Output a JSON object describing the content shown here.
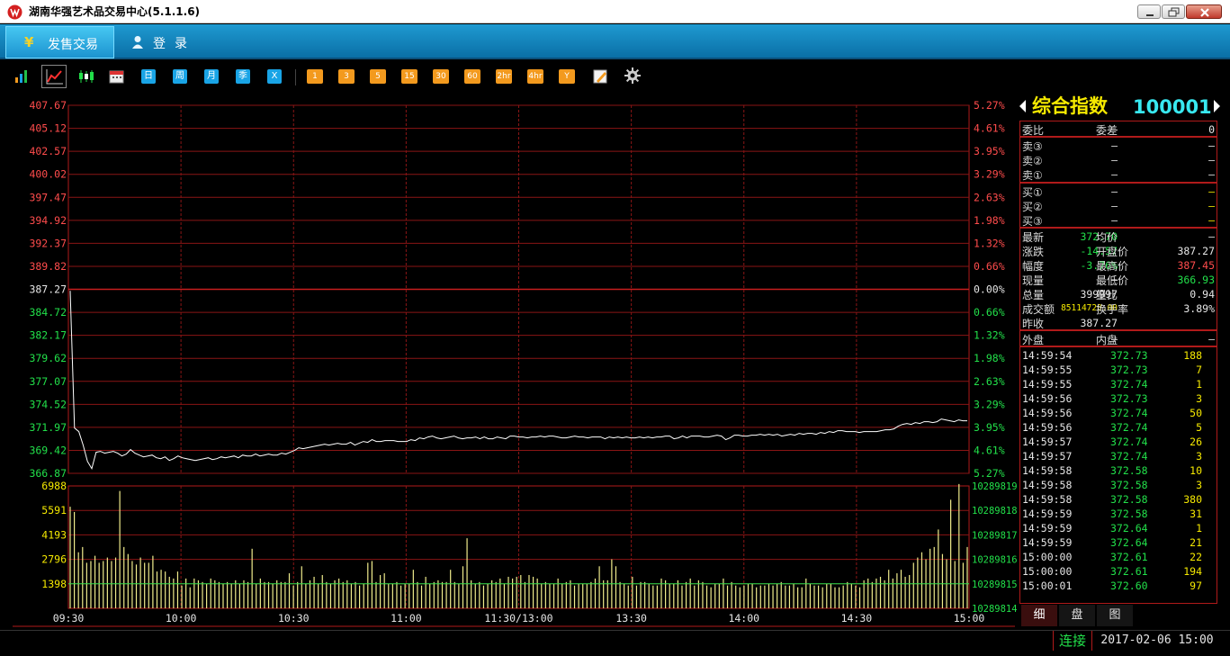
{
  "window": {
    "title": "湖南华强艺术品交易中心(5.1.1.6)"
  },
  "nav": {
    "trade_label": "发售交易",
    "login_label": "登录"
  },
  "toolbar": {
    "periods": [
      "日",
      "周",
      "月",
      "季",
      "X"
    ],
    "minutes": [
      "1",
      "3",
      "5",
      "15",
      "30",
      "60",
      "2hr",
      "4hr",
      "Y"
    ],
    "icons": [
      "bar-chart-icon",
      "line-chart-icon",
      "candlestick-icon",
      "calendar-icon",
      "draw-icon",
      "gear-icon"
    ]
  },
  "quote": {
    "name": "综合指数",
    "code": "100001",
    "weibi_label": "委比",
    "weibi_value": "—",
    "weicha_label": "委差",
    "weicha_value": "0",
    "sells": [
      {
        "label": "卖③",
        "price": "—",
        "vol": "—"
      },
      {
        "label": "卖②",
        "price": "—",
        "vol": "—"
      },
      {
        "label": "卖①",
        "price": "—",
        "vol": "—"
      }
    ],
    "buys": [
      {
        "label": "买①",
        "price": "—",
        "vol": "—"
      },
      {
        "label": "买②",
        "price": "—",
        "vol": "—"
      },
      {
        "label": "买③",
        "price": "—",
        "vol": "—"
      }
    ],
    "stats_left": [
      {
        "label": "最新",
        "value": "372.70",
        "color": "grn"
      },
      {
        "label": "涨跌",
        "value": "-14.57",
        "color": "grn"
      },
      {
        "label": "幅度",
        "value": "-3.76%",
        "color": "grn"
      },
      {
        "label": "现量",
        "value": "—",
        "color": "wht"
      },
      {
        "label": "总量",
        "value": "399997",
        "color": "wht"
      },
      {
        "label": "成交额",
        "value": "85114720.00",
        "color": "yel"
      },
      {
        "label": "昨收",
        "value": "387.27",
        "color": "wht"
      }
    ],
    "stats_right": [
      {
        "label": "均价",
        "value": "—",
        "color": "wht"
      },
      {
        "label": "开盘价",
        "value": "387.27",
        "color": "wht"
      },
      {
        "label": "最高价",
        "value": "387.45",
        "color": "red"
      },
      {
        "label": "最低价",
        "value": "366.93",
        "color": "grn"
      },
      {
        "label": "量比",
        "value": "0.94",
        "color": "wht"
      },
      {
        "label": "换手率",
        "value": "3.89%",
        "color": "wht"
      }
    ],
    "outer_label": "外盘",
    "outer_value": "—",
    "inner_label": "内盘",
    "inner_value": "—"
  },
  "ticks": [
    [
      "14:59:54",
      "372.73",
      "188"
    ],
    [
      "14:59:55",
      "372.73",
      "7"
    ],
    [
      "14:59:55",
      "372.74",
      "1"
    ],
    [
      "14:59:56",
      "372.73",
      "3"
    ],
    [
      "14:59:56",
      "372.74",
      "50"
    ],
    [
      "14:59:56",
      "372.74",
      "5"
    ],
    [
      "14:59:57",
      "372.74",
      "26"
    ],
    [
      "14:59:57",
      "372.74",
      "3"
    ],
    [
      "14:59:58",
      "372.58",
      "10"
    ],
    [
      "14:59:58",
      "372.58",
      "3"
    ],
    [
      "14:59:58",
      "372.58",
      "380"
    ],
    [
      "14:59:59",
      "372.58",
      "31"
    ],
    [
      "14:59:59",
      "372.64",
      "1"
    ],
    [
      "14:59:59",
      "372.64",
      "21"
    ],
    [
      "15:00:00",
      "372.61",
      "22"
    ],
    [
      "15:00:00",
      "372.61",
      "194"
    ],
    [
      "15:00:01",
      "372.60",
      "97"
    ]
  ],
  "tabs": [
    "细",
    "盘",
    "图"
  ],
  "status": {
    "connection": "连接",
    "datetime": "2017-02-06 15:00"
  },
  "chart_data": {
    "type": "line",
    "prev_close": 387.27,
    "price_labels": [
      "407.67",
      "405.12",
      "402.57",
      "400.02",
      "397.47",
      "394.92",
      "392.37",
      "389.82",
      "387.27",
      "384.72",
      "382.17",
      "379.62",
      "377.07",
      "374.52",
      "371.97",
      "369.42",
      "366.87"
    ],
    "pct_labels": [
      "5.27%",
      "4.61%",
      "3.95%",
      "3.29%",
      "2.63%",
      "1.98%",
      "1.32%",
      "0.66%",
      "0.00%",
      "0.66%",
      "1.32%",
      "1.98%",
      "2.63%",
      "3.29%",
      "3.95%",
      "4.61%",
      "5.27%"
    ],
    "ylim": [
      366.87,
      407.67
    ],
    "x_labels": [
      "09:30",
      "10:00",
      "10:30",
      "11:00",
      "11:30/13:00",
      "13:30",
      "14:00",
      "14:30",
      "15:00"
    ],
    "price_series": [
      387.1,
      371.9,
      371.5,
      370.0,
      368.2,
      367.4,
      369.2,
      369.3,
      369.1,
      369.2,
      369.3,
      369.1,
      368.8,
      369.0,
      369.5,
      369.1,
      368.9,
      368.7,
      368.8,
      368.9,
      368.6,
      368.5,
      368.7,
      368.3,
      368.5,
      368.8,
      368.6,
      368.5,
      368.4,
      368.3,
      368.4,
      368.5,
      368.6,
      368.4,
      368.5,
      368.7,
      368.6,
      368.7,
      368.8,
      368.6,
      368.9,
      368.8,
      368.8,
      369.0,
      368.8,
      368.9,
      369.0,
      368.9,
      368.9,
      369.1,
      369.0,
      369.2,
      369.4,
      369.7,
      369.6,
      369.7,
      369.8,
      369.9,
      370.0,
      370.1,
      370.0,
      370.1,
      370.2,
      370.1,
      370.1,
      370.3,
      370.0,
      370.2,
      370.4,
      370.3,
      370.6,
      370.4,
      370.4,
      370.5,
      370.5,
      370.5,
      370.4,
      370.4,
      370.4,
      370.6,
      370.5,
      370.8,
      370.7,
      370.9,
      371.0,
      370.8,
      370.7,
      370.8,
      370.9,
      371.0,
      370.8,
      370.7,
      370.8,
      370.8,
      370.9,
      370.7,
      370.9,
      370.7,
      370.7,
      370.9,
      370.8,
      370.7,
      371.0,
      371.0,
      370.9,
      370.9,
      370.8,
      370.9,
      370.9,
      371.0,
      370.9,
      371.0,
      371.0,
      370.9,
      370.8,
      370.8,
      370.9,
      371.0,
      370.9,
      370.9,
      370.8,
      370.9,
      370.9,
      370.9,
      370.7,
      370.9,
      370.8,
      370.9,
      370.8,
      370.9,
      370.8,
      370.8,
      370.9,
      370.8,
      370.9,
      370.8,
      370.9,
      370.9,
      371.0,
      371.0,
      370.7,
      370.8,
      371.0,
      370.8,
      371.0,
      371.0,
      371.0,
      370.9,
      370.9,
      371.0,
      371.1,
      371.0,
      370.6,
      370.8,
      371.1,
      371.1,
      371.0,
      371.0,
      371.1,
      371.1,
      371.2,
      371.1,
      371.2,
      371.1,
      371.2,
      371.0,
      371.1,
      371.2,
      371.1,
      371.3,
      371.2,
      371.3,
      371.3,
      371.2,
      371.4,
      371.3,
      371.5,
      371.4,
      371.6,
      371.6,
      371.5,
      371.5,
      371.5,
      371.4,
      371.5,
      371.5,
      371.5,
      371.5,
      371.6,
      371.7,
      371.7,
      371.8,
      372.1,
      372.3,
      372.4,
      372.3,
      372.5,
      372.4,
      372.6,
      372.6,
      372.5,
      372.6,
      372.9,
      372.8,
      372.7,
      372.6,
      372.8,
      372.7,
      372.7
    ],
    "volume_labels": [
      "6988",
      "5591",
      "4193",
      "2796",
      "1398"
    ],
    "volume_right_labels": [
      "10289819",
      "10289818",
      "10289817",
      "10289816",
      "10289815",
      "10289814"
    ],
    "volume_max": 6988,
    "volume_avg_level": 1398,
    "volumes": [
      5800,
      5500,
      3200,
      3500,
      2600,
      2700,
      3000,
      2600,
      2700,
      2900,
      2700,
      2900,
      6700,
      3500,
      3100,
      2700,
      2500,
      2900,
      2600,
      2600,
      3000,
      2100,
      2200,
      2100,
      1800,
      1700,
      2100,
      1300,
      1700,
      1200,
      1700,
      1600,
      1500,
      1400,
      1700,
      1600,
      1500,
      1400,
      1500,
      1400,
      1600,
      1400,
      1600,
      1500,
      3400,
      1400,
      1700,
      1500,
      1500,
      1400,
      1600,
      1500,
      1500,
      2000,
      1300,
      1500,
      2400,
      1400,
      1600,
      1800,
      1400,
      1900,
      1500,
      1400,
      1600,
      1700,
      1500,
      1600,
      1400,
      1500,
      1300,
      1400,
      2600,
      2700,
      1500,
      1900,
      2000,
      1400,
      1400,
      1500,
      1300,
      1400,
      1400,
      2200,
      1500,
      1300,
      1800,
      1400,
      1500,
      1600,
      1500,
      1500,
      2200,
      1500,
      1400,
      2400,
      4000,
      1600,
      1400,
      1500,
      1300,
      1400,
      1600,
      1500,
      1700,
      1400,
      1800,
      1700,
      1800,
      1900,
      1500,
      1900,
      1800,
      1700,
      1400,
      1500,
      1400,
      1400,
      1700,
      1400,
      1500,
      1600,
      1300,
      1400,
      1400,
      1400,
      1500,
      1700,
      2400,
      1600,
      1600,
      2800,
      2400,
      1500,
      1400,
      1300,
      1800,
      1300,
      1500,
      1500,
      1400,
      1300,
      1300,
      1700,
      1600,
      1400,
      1400,
      1600,
      1300,
      1500,
      1700,
      1300,
      1600,
      1500,
      1300,
      1200,
      1400,
      1400,
      1700,
      1300,
      1500,
      1300,
      1200,
      1300,
      1400,
      1400,
      1200,
      1300,
      1300,
      1400,
      1300,
      1400,
      1500,
      1300,
      1300,
      1400,
      1200,
      1200,
      1700,
      1400,
      1300,
      1300,
      1200,
      1400,
      1400,
      1200,
      1200,
      1300,
      1500,
      1400,
      1300,
      1200,
      1600,
      1700,
      1500,
      1700,
      1800,
      1600,
      2200,
      1700,
      2000,
      2200,
      1800,
      1900,
      2600,
      2900,
      3200,
      2800,
      3400,
      3500,
      4500,
      3100,
      2800,
      6200,
      2700,
      7100,
      2600,
      3500
    ]
  }
}
